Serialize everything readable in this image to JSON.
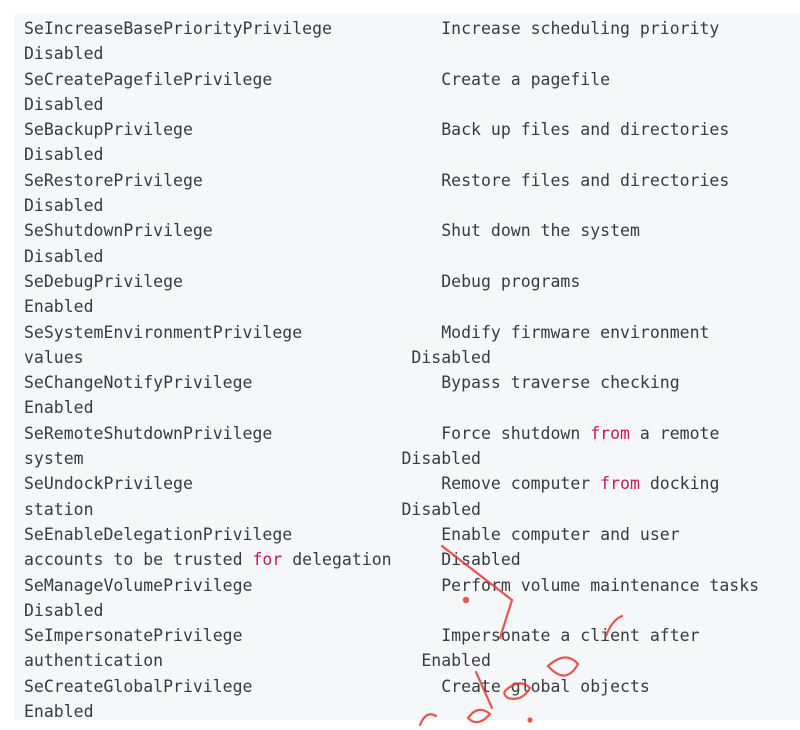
{
  "keyword_color": "#c2185b",
  "text_color": "#383a42",
  "background_color": "#f6f7f8",
  "lines": [
    [
      {
        "t": "SeIncreaseBasePriorityPrivilege           Increase scheduling priority"
      }
    ],
    [
      {
        "t": "Disabled"
      }
    ],
    [
      {
        "t": "SeCreatePagefilePrivilege                 Create a pagefile"
      }
    ],
    [
      {
        "t": "Disabled"
      }
    ],
    [
      {
        "t": "SeBackupPrivilege                         Back up files and directories"
      }
    ],
    [
      {
        "t": "Disabled"
      }
    ],
    [
      {
        "t": "SeRestorePrivilege                        Restore files and directories"
      }
    ],
    [
      {
        "t": "Disabled"
      }
    ],
    [
      {
        "t": "SeShutdownPrivilege                       Shut down the system"
      }
    ],
    [
      {
        "t": "Disabled"
      }
    ],
    [
      {
        "t": "SeDebugPrivilege                          Debug programs"
      }
    ],
    [
      {
        "t": "Enabled"
      }
    ],
    [
      {
        "t": "SeSystemEnvironmentPrivilege              Modify firmware environment"
      }
    ],
    [
      {
        "t": "values                                 Disabled"
      }
    ],
    [
      {
        "t": "SeChangeNotifyPrivilege                   Bypass traverse checking"
      }
    ],
    [
      {
        "t": "Enabled"
      }
    ],
    [
      {
        "t": "SeRemoteShutdownPrivilege                 Force shutdown "
      },
      {
        "t": "from",
        "kw": true
      },
      {
        "t": " a remote"
      }
    ],
    [
      {
        "t": "system                                Disabled"
      }
    ],
    [
      {
        "t": "SeUndockPrivilege                         Remove computer "
      },
      {
        "t": "from",
        "kw": true
      },
      {
        "t": " docking"
      }
    ],
    [
      {
        "t": "station                               Disabled"
      }
    ],
    [
      {
        "t": "SeEnableDelegationPrivilege               Enable computer and user"
      }
    ],
    [
      {
        "t": "accounts to be trusted "
      },
      {
        "t": "for",
        "kw": true
      },
      {
        "t": " delegation     Disabled"
      }
    ],
    [
      {
        "t": "SeManageVolumePrivilege                   Perform volume maintenance tasks"
      }
    ],
    [
      {
        "t": "Disabled"
      }
    ],
    [
      {
        "t": "SeImpersonatePrivilege                    Impersonate a client after"
      }
    ],
    [
      {
        "t": "authentication                          Enabled"
      }
    ],
    [
      {
        "t": "SeCreateGlobalPrivilege                   Create global objects"
      }
    ],
    [
      {
        "t": "Enabled"
      }
    ]
  ]
}
